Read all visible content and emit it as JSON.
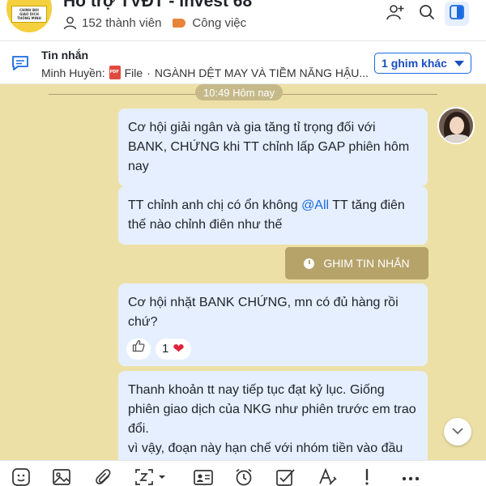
{
  "header": {
    "group_name": "Hỗ trợ TVĐT - Invest 68",
    "member_count": "152 thành viên",
    "category": "Công việc",
    "avatar_text": [
      "CHINH BOI",
      "GIAO DICH",
      "THÔNG MINH"
    ]
  },
  "pinned": {
    "title": "Tin nhắn",
    "sender": "Minh Huyền:",
    "file_label": "File",
    "file_name": "NGÀNH DỆT MAY VÀ TIỀM NĂNG HẬU...",
    "more_label": "1 ghim khác"
  },
  "chat": {
    "time_divider": "10:49 Hôm nay",
    "messages": [
      {
        "text": "Cơ hội giải ngân và gia tăng tỉ trọng đối với BANK, CHỨNG khi TT chỉnh lấp GAP phiên hôm nay"
      },
      {
        "text_before": "TT chỉnh anh chị có ổn không ",
        "mention": "@All",
        "text_after": "  TT tăng điên thế nào chỉnh điên như thế"
      },
      {
        "text": "Cơ hội nhặt BANK CHỨNG, mn có đủ hàng rồi chứ?",
        "reaction_count": "1"
      },
      {
        "text_lines": [
          "Thanh khoản tt nay tiếp tục đạt kỷ lục. Giống phiên giao dịch của NKG như phiên trước em trao đổi.",
          "vì vậy, đoạn này hạn chế với nhóm tiền vào đầu cơ"
        ]
      }
    ],
    "pin_message_label": "GHIM TIN NHẮN"
  },
  "colors": {
    "chat_background": "#ede0a6",
    "bubble": "#e5efff",
    "accent": "#1a6ae0",
    "pin_button": "#b6a36a"
  },
  "icons": {
    "header": [
      "add-user-icon",
      "search-icon",
      "panel-toggle-icon"
    ],
    "toolbar": [
      "sticker-icon",
      "image-icon",
      "attachment-icon",
      "screenshot-icon",
      "contact-card-icon",
      "reminder-icon",
      "task-icon",
      "format-text-icon",
      "urgent-icon",
      "more-icon"
    ]
  }
}
